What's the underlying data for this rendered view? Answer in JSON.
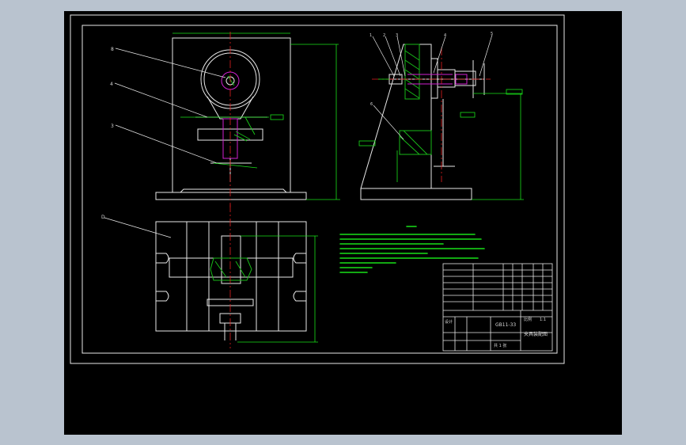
{
  "window": {
    "background": "#b9c3cf",
    "canvas_color": "#000000"
  },
  "colors": {
    "outline": "#e8e8e8",
    "dimension": "#18e018",
    "centerline": "#e02020",
    "part": "#d020d0",
    "hatch": "#18b818"
  },
  "callouts": {
    "front_top": "8",
    "front_mid": "4",
    "front_low": "3",
    "top_view": "D",
    "side_1": "1",
    "side_2": "2",
    "side_3": "3",
    "side_4": "4",
    "side_5": "5",
    "side_6": "6"
  },
  "title_block": {
    "drawing_no": "GB11-33",
    "title": "夹具装配图",
    "scale_label": "比例",
    "scale": "1:1",
    "sheet": "共 1 张",
    "designer": "设计"
  }
}
